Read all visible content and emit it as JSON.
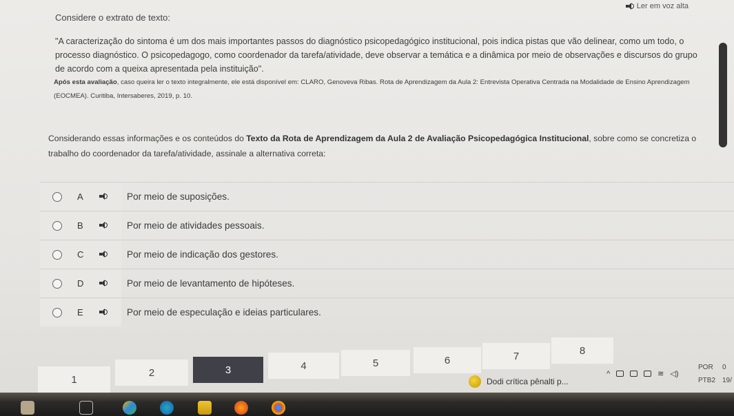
{
  "listen_aloud": "Ler em voz alta",
  "heading": "Considere o extrato de texto:",
  "quote": "\"A caracterização do sintoma é um dos mais importantes passos do diagnóstico psicopedagógico institucional, pois indica pistas que vão delinear, como um todo, o processo diagnóstico. O psicopedagogo, como coordenador da tarefa/atividade, deve observar a temática e a dinâmica por meio de observações e discursos do grupo de acordo com a queixa apresentada pela instituição\".",
  "source_bold": "Após esta avaliação",
  "source_rest": ", caso queira ler o texto integralmente, ele está disponível em: CLARO, Genoveva Ribas. Rota de Aprendizagem da Aula 2: Entrevista Operativa Centrada na Modalidade de Ensino Aprendizagem (EOCMEA). Curitiba, Intersaberes, 2019, p. 10.",
  "prompt_start": "Considerando essas informações e os conteúdos do ",
  "prompt_bold": "Texto da Rota de Aprendizagem da Aula 2 de Avaliação Psicopedagógica Institucional",
  "prompt_end": ", sobre como se concretiza o trabalho do coordenador da tarefa/atividade, assinale a alternativa correta:",
  "options": [
    {
      "letter": "A",
      "text": "Por meio de suposições."
    },
    {
      "letter": "B",
      "text": "Por meio de atividades pessoais."
    },
    {
      "letter": "C",
      "text": "Por meio de indicação dos gestores."
    },
    {
      "letter": "D",
      "text": "Por meio de levantamento de hipóteses."
    },
    {
      "letter": "E",
      "text": "Por meio de especulação e ideias particulares."
    }
  ],
  "pager": [
    "1",
    "2",
    "3",
    "4",
    "5",
    "6",
    "7",
    "8"
  ],
  "pager_active": "3",
  "news_text": "Dodi crítica pênalti p...",
  "lang_top": "POR",
  "lang_bottom": "PTB2",
  "clock_top": "0",
  "clock_bottom": "19/",
  "colors": {
    "active_page": "#3f4048",
    "background": "#e6e5e2"
  }
}
